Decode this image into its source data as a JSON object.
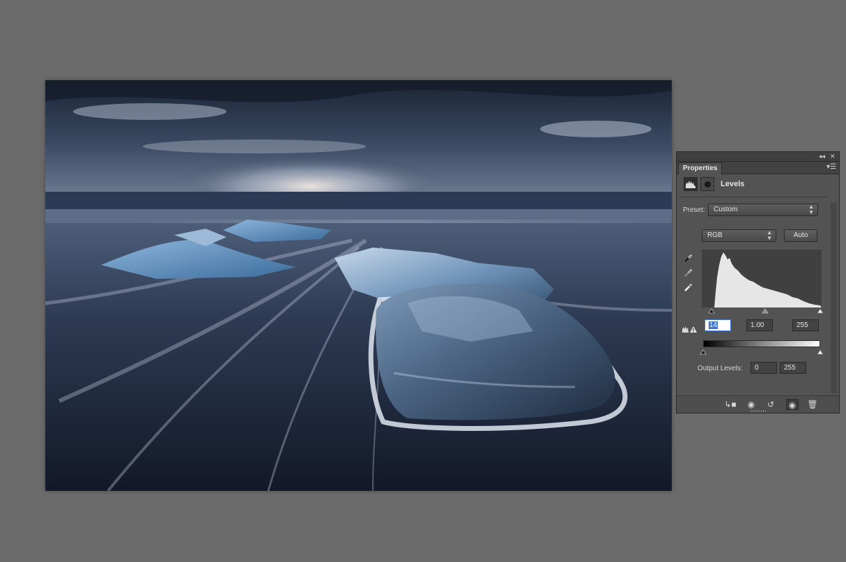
{
  "panel": {
    "tab_label": "Properties",
    "collapse_icon": "double-chevron-left-icon",
    "close_icon": "close-icon",
    "menu_icon": "panel-menu-icon",
    "header_title": "Levels",
    "preset_label": "Preset:",
    "preset_value": "Custom",
    "channel_value": "RGB",
    "auto_label": "Auto",
    "input_black": "14",
    "input_gamma": "1.00",
    "input_white": "255",
    "output_label": "Output Levels:",
    "output_black": "0",
    "output_white": "255"
  },
  "colors": {
    "panel_bg": "#535353",
    "workspace_bg": "#6b6b6b",
    "selection": "#3875d7"
  }
}
